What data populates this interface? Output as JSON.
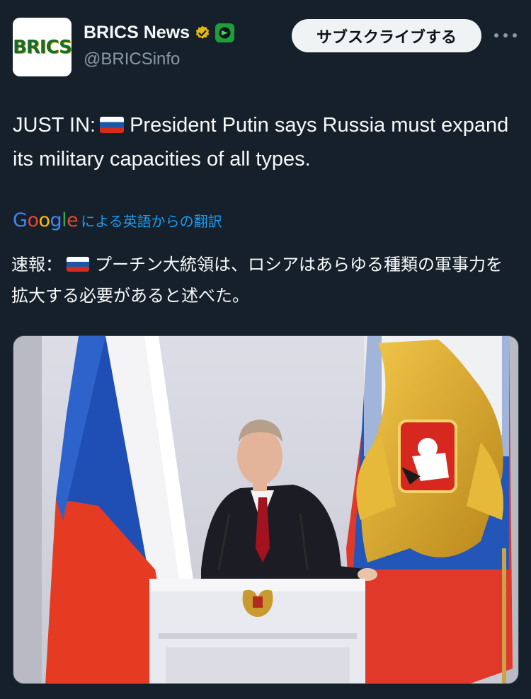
{
  "account": {
    "avatar_text": "BRICS",
    "display_name": "BRICS News",
    "handle": "@BRICSinfo",
    "verified_icon": "gold-verified-badge-icon",
    "affiliate_icon": "affiliate-badge-icon"
  },
  "actions": {
    "subscribe_label": "サブスクライブする",
    "more_icon": "more-horizontal-icon"
  },
  "tweet": {
    "text_prefix": "JUST IN:",
    "flag_icon": "russia-flag-emoji",
    "text_body": "President Putin says Russia must expand its military capacities of all types."
  },
  "translation": {
    "provider": "Google",
    "label": "による英語からの翻訳",
    "text_prefix": "速報：",
    "text_body": "プーチン大統領は、ロシアはあらゆる種類の軍事力を拡大する必要があると述べた。"
  },
  "media": {
    "type": "photo"
  },
  "colors": {
    "background": "#15202b",
    "link": "#1d9bf0",
    "secondary_text": "#8b98a5"
  }
}
